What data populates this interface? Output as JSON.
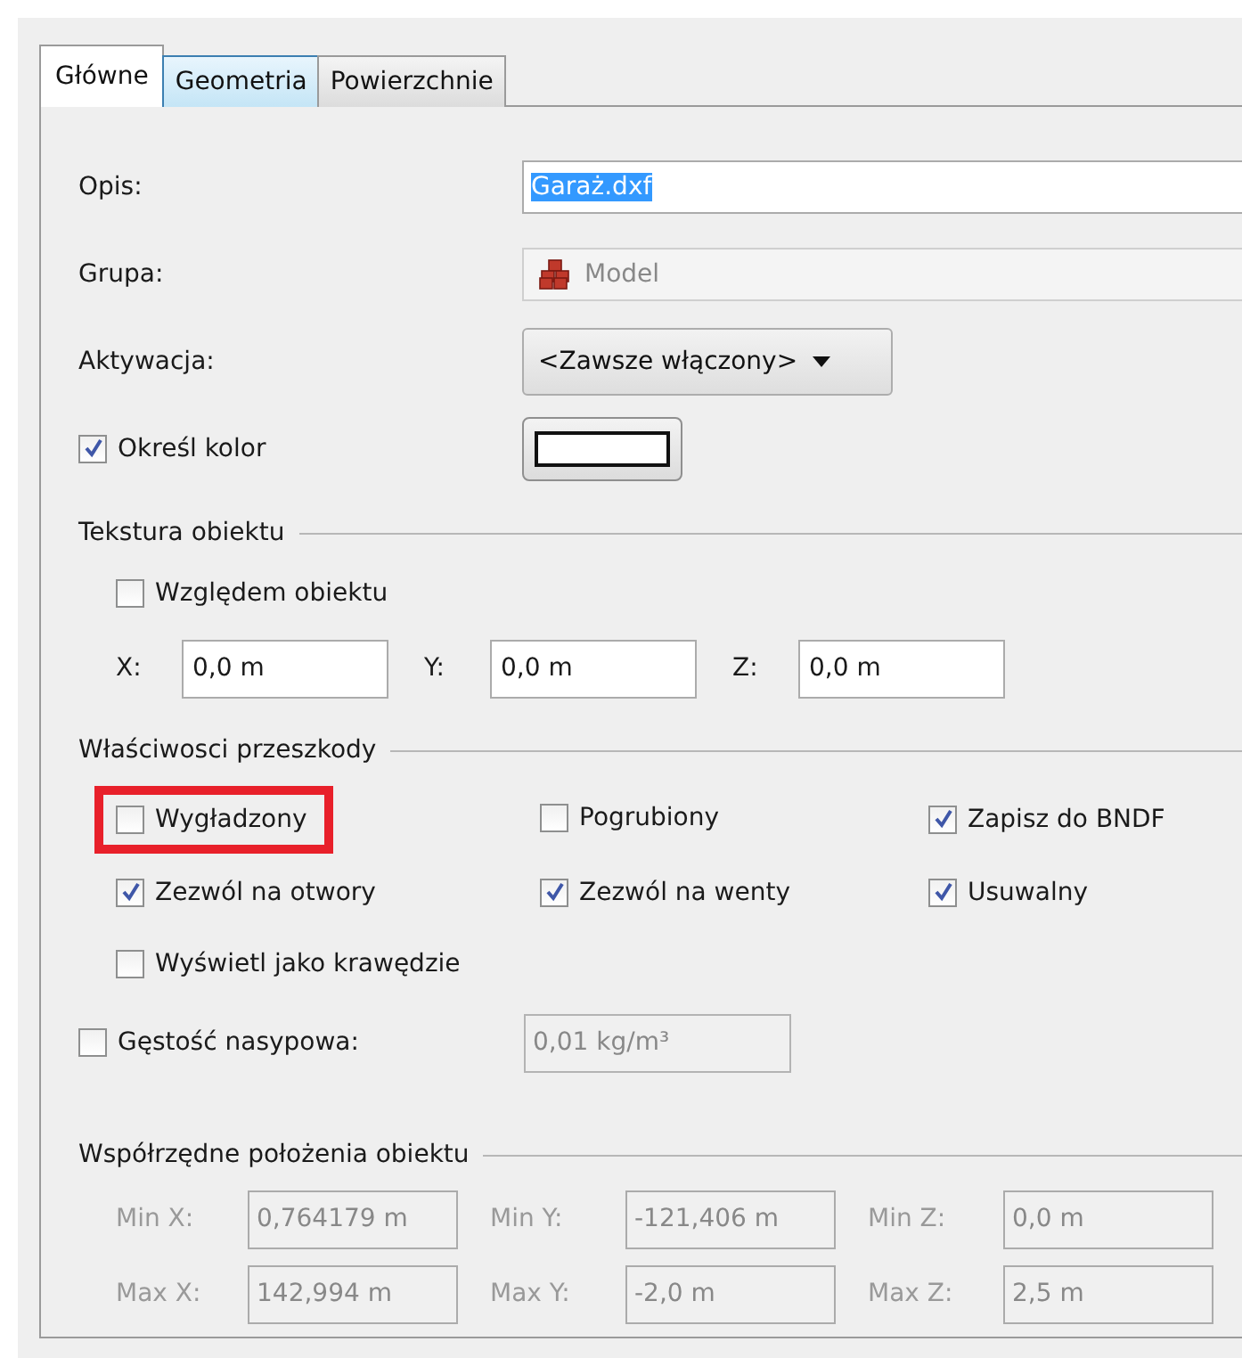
{
  "tabs": [
    {
      "label": "Główne",
      "selected": true,
      "hovered": false
    },
    {
      "label": "Geometria",
      "selected": false,
      "hovered": true
    },
    {
      "label": "Powierzchnie",
      "selected": false,
      "hovered": false
    }
  ],
  "general": {
    "description": {
      "label": "Opis:",
      "value": "Garaż.dxf",
      "text_selected": true
    },
    "group": {
      "label": "Grupa:",
      "value": "Model"
    },
    "activation": {
      "label": "Aktywacja:",
      "value": "<Zawsze włączony>"
    },
    "color": {
      "label": "Określ kolor",
      "checked": true,
      "color": "#ffffff"
    }
  },
  "texture": {
    "title": "Tekstura obiektu",
    "relative": {
      "label": "Względem obiektu",
      "checked": false
    },
    "coords": [
      {
        "label": "X:",
        "value": "0,0 m"
      },
      {
        "label": "Y:",
        "value": "0,0 m"
      },
      {
        "label": "Z:",
        "value": "0,0 m"
      }
    ]
  },
  "obstruction": {
    "title": "Właściwosci przeszkody",
    "options": [
      {
        "label": "Wygładzony",
        "checked": false,
        "highlighted": true
      },
      {
        "label": "Pogrubiony",
        "checked": false,
        "highlighted": false
      },
      {
        "label": "Zapisz do BNDF",
        "checked": true,
        "highlighted": false
      },
      {
        "label": "Zezwól na otwory",
        "checked": true,
        "highlighted": false
      },
      {
        "label": "Zezwól na wenty",
        "checked": true,
        "highlighted": false
      },
      {
        "label": "Usuwalny",
        "checked": true,
        "highlighted": false
      },
      {
        "label": "Wyświetl jako krawędzie",
        "checked": false,
        "highlighted": false
      }
    ],
    "density": {
      "label": "Gęstość nasypowa:",
      "checked": false,
      "value": "0,01 kg/m³",
      "disabled": true
    }
  },
  "position": {
    "title": "Współrzędne położenia obiektu",
    "disabled": true,
    "fields": [
      {
        "label": "Min X:",
        "value": "0,764179 m"
      },
      {
        "label": "Min Y:",
        "value": "-121,406 m"
      },
      {
        "label": "Min Z:",
        "value": "0,0 m"
      },
      {
        "label": "Max X:",
        "value": "142,994 m"
      },
      {
        "label": "Max Y:",
        "value": "-2,0 m"
      },
      {
        "label": "Max Z:",
        "value": "2,5 m"
      }
    ]
  }
}
